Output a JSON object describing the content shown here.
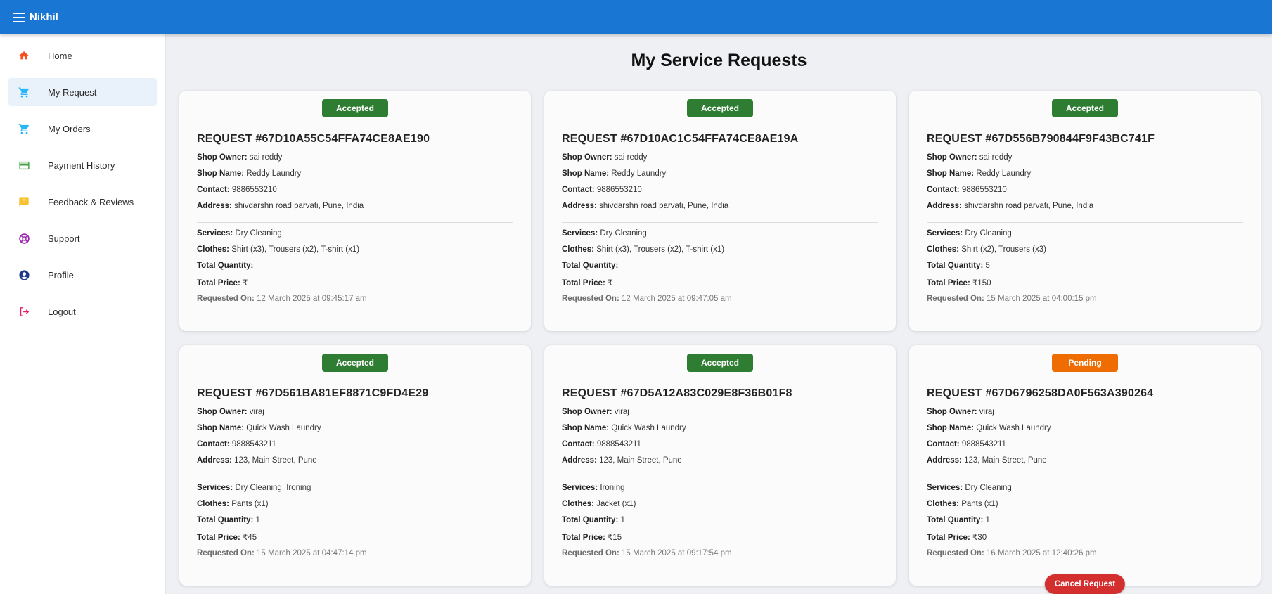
{
  "appbar": {
    "title": "Nikhil",
    "menu_icon": "hamburger-menu-icon",
    "color": "#1976d2"
  },
  "sidebar": {
    "items": [
      {
        "label": "Home",
        "icon": "home-icon",
        "color": "#f4511e",
        "active": false
      },
      {
        "label": "My Request",
        "icon": "cart-icon",
        "color": "#29b6f6",
        "active": true
      },
      {
        "label": "My Orders",
        "icon": "cart-icon",
        "color": "#29b6f6",
        "active": false
      },
      {
        "label": "Payment History",
        "icon": "credit-card-icon",
        "color": "#43a047",
        "active": false
      },
      {
        "label": "Feedback & Reviews",
        "icon": "feedback-icon",
        "color": "#fbc02d",
        "active": false
      },
      {
        "label": "Support",
        "icon": "support-icon",
        "color": "#9c27b0",
        "active": false
      },
      {
        "label": "Profile",
        "icon": "account-circle-icon",
        "color": "#1e3a8a",
        "active": false
      },
      {
        "label": "Logout",
        "icon": "logout-icon",
        "color": "#e91e63",
        "active": false
      }
    ]
  },
  "main": {
    "title": "My Service Requests"
  },
  "labels": {
    "shop_owner": "Shop Owner:",
    "shop_name": "Shop Name:",
    "contact": "Contact:",
    "address": "Address:",
    "services": "Services:",
    "clothes": "Clothes:",
    "total_quantity": "Total Quantity:",
    "total_price": "Total Price:",
    "requested_on": "Requested On:"
  },
  "status_colors": {
    "Accepted": "#2e7d32",
    "Pending": "#ef6c00"
  },
  "requests": [
    {
      "status": "Accepted",
      "title": "REQUEST #67D10A55C54FFA74CE8AE190",
      "shop_owner": "sai reddy",
      "shop_name": "Reddy Laundry",
      "contact": "9886553210",
      "address": "shivdarshn road parvati, Pune, India",
      "services": "Dry Cleaning",
      "clothes": "Shirt (x3), Trousers (x2), T-shirt (x1)",
      "total_quantity": "",
      "total_price": "₹",
      "requested_on": "12 March 2025 at 09:45:17 am"
    },
    {
      "status": "Accepted",
      "title": "REQUEST #67D10AC1C54FFA74CE8AE19A",
      "shop_owner": "sai reddy",
      "shop_name": "Reddy Laundry",
      "contact": "9886553210",
      "address": "shivdarshn road parvati, Pune, India",
      "services": "Dry Cleaning",
      "clothes": "Shirt (x3), Trousers (x2), T-shirt (x1)",
      "total_quantity": "",
      "total_price": "₹",
      "requested_on": "12 March 2025 at 09:47:05 am"
    },
    {
      "status": "Accepted",
      "title": "REQUEST #67D556B790844F9F43BC741F",
      "shop_owner": "sai reddy",
      "shop_name": "Reddy Laundry",
      "contact": "9886553210",
      "address": "shivdarshn road parvati, Pune, India",
      "services": "Dry Cleaning",
      "clothes": "Shirt (x2), Trousers (x3)",
      "total_quantity": "5",
      "total_price": "₹150",
      "requested_on": "15 March 2025 at 04:00:15 pm"
    },
    {
      "status": "Accepted",
      "title": "REQUEST #67D561BA81EF8871C9FD4E29",
      "shop_owner": "viraj",
      "shop_name": "Quick Wash Laundry",
      "contact": "9888543211",
      "address": "123, Main Street, Pune",
      "services": "Dry Cleaning, Ironing",
      "clothes": "Pants (x1)",
      "total_quantity": "1",
      "total_price": "₹45",
      "requested_on": "15 March 2025 at 04:47:14 pm"
    },
    {
      "status": "Accepted",
      "title": "REQUEST #67D5A12A83C029E8F36B01F8",
      "shop_owner": "viraj",
      "shop_name": "Quick Wash Laundry",
      "contact": "9888543211",
      "address": "123, Main Street, Pune",
      "services": "Ironing",
      "clothes": "Jacket (x1)",
      "total_quantity": "1",
      "total_price": "₹15",
      "requested_on": "15 March 2025 at 09:17:54 pm"
    },
    {
      "status": "Pending",
      "title": "REQUEST #67D6796258DA0F563A390264",
      "shop_owner": "viraj",
      "shop_name": "Quick Wash Laundry",
      "contact": "9888543211",
      "address": "123, Main Street, Pune",
      "services": "Dry Cleaning",
      "clothes": "Pants (x1)",
      "total_quantity": "1",
      "total_price": "₹30",
      "requested_on": "16 March 2025 at 12:40:26 pm",
      "cancel_label": "Cancel Request"
    }
  ]
}
